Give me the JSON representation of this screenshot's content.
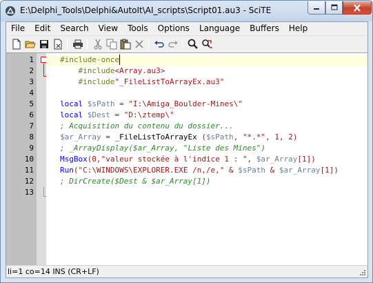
{
  "window": {
    "title": "E:\\Delphi_Tools\\Delphi&AutoIt\\AI_scripts\\Script01.au3 - SciTE"
  },
  "menu": {
    "items": [
      "File",
      "Edit",
      "Search",
      "View",
      "Tools",
      "Options",
      "Language",
      "Buffers",
      "Help"
    ]
  },
  "toolbar": {
    "buttons": [
      "new-file-icon",
      "open-folder-icon",
      "save-icon",
      "close-file-icon",
      "print-icon",
      "cut-icon",
      "copy-icon",
      "paste-icon",
      "delete-icon",
      "undo-icon",
      "redo-icon",
      "find-icon",
      "replace-icon"
    ]
  },
  "editor": {
    "line_numbers": [
      "1",
      "2",
      "3",
      "4",
      "5",
      "6",
      "7",
      "8",
      "9",
      "10",
      "11",
      "12",
      "13"
    ],
    "lines": [
      {
        "tokens": [
          [
            "pre",
            "#include-once"
          ]
        ]
      },
      {
        "tokens": [
          [
            "plain",
            "    "
          ],
          [
            "pre",
            "#include"
          ],
          [
            "inc",
            "<Array.au3>"
          ]
        ]
      },
      {
        "tokens": [
          [
            "plain",
            "    "
          ],
          [
            "pre",
            "#include"
          ],
          [
            "inc",
            "\"_FileListToArrayEx.au3\""
          ]
        ]
      },
      {
        "tokens": []
      },
      {
        "tokens": [
          [
            "kw",
            "local "
          ],
          [
            "var",
            "$sPath"
          ],
          [
            "plain",
            " "
          ],
          [
            "op",
            "="
          ],
          [
            "plain",
            " "
          ],
          [
            "str",
            "\"I:\\Amiga_Boulder-Mines\\\""
          ]
        ]
      },
      {
        "tokens": [
          [
            "kw",
            "local "
          ],
          [
            "var",
            "$Dest"
          ],
          [
            "plain",
            " "
          ],
          [
            "op",
            "="
          ],
          [
            "plain",
            " "
          ],
          [
            "str",
            "\"D:\\ztemp\\\""
          ]
        ]
      },
      {
        "tokens": [
          [
            "cmt",
            "; Acquisition du contenu du dossier..."
          ]
        ]
      },
      {
        "tokens": [
          [
            "var",
            "$ar_Array"
          ],
          [
            "plain",
            " "
          ],
          [
            "op",
            "="
          ],
          [
            "plain",
            " _FileListToArrayEx "
          ],
          [
            "op",
            "("
          ],
          [
            "var",
            "$sPath"
          ],
          [
            "op",
            ","
          ],
          [
            "plain",
            " "
          ],
          [
            "str",
            "\"*.*\""
          ],
          [
            "op",
            ","
          ],
          [
            "plain",
            " "
          ],
          [
            "num",
            "1"
          ],
          [
            "op",
            ","
          ],
          [
            "plain",
            " "
          ],
          [
            "num",
            "2"
          ],
          [
            "op",
            ")"
          ]
        ]
      },
      {
        "tokens": [
          [
            "cmt",
            "; _ArrayDisplay($ar_Array, \"Liste des Mines\")"
          ]
        ]
      },
      {
        "tokens": [
          [
            "kw",
            "MsgBox"
          ],
          [
            "op",
            "("
          ],
          [
            "num",
            "0"
          ],
          [
            "op",
            ","
          ],
          [
            "str",
            "\"valeur stockée à l'indice 1 : \""
          ],
          [
            "op",
            ","
          ],
          [
            "plain",
            " "
          ],
          [
            "var",
            "$ar_Array"
          ],
          [
            "op",
            "["
          ],
          [
            "num",
            "1"
          ],
          [
            "op",
            "])"
          ]
        ]
      },
      {
        "tokens": [
          [
            "kw",
            "Run"
          ],
          [
            "op",
            "("
          ],
          [
            "str",
            "\"C:\\WINDOWS\\EXPLORER.EXE /n,/e,\""
          ],
          [
            "plain",
            " "
          ],
          [
            "op",
            "&"
          ],
          [
            "plain",
            " "
          ],
          [
            "var",
            "$sPath"
          ],
          [
            "plain",
            " "
          ],
          [
            "op",
            "&"
          ],
          [
            "plain",
            " "
          ],
          [
            "var",
            "$ar_Array"
          ],
          [
            "op",
            "["
          ],
          [
            "num",
            "1"
          ],
          [
            "op",
            "])"
          ]
        ]
      },
      {
        "tokens": [
          [
            "cmt",
            "; DirCreate($Dest & $ar_Array[1])"
          ]
        ]
      },
      {
        "tokens": []
      }
    ]
  },
  "status": {
    "text": "li=1 co=14 INS (CR+LF)"
  }
}
